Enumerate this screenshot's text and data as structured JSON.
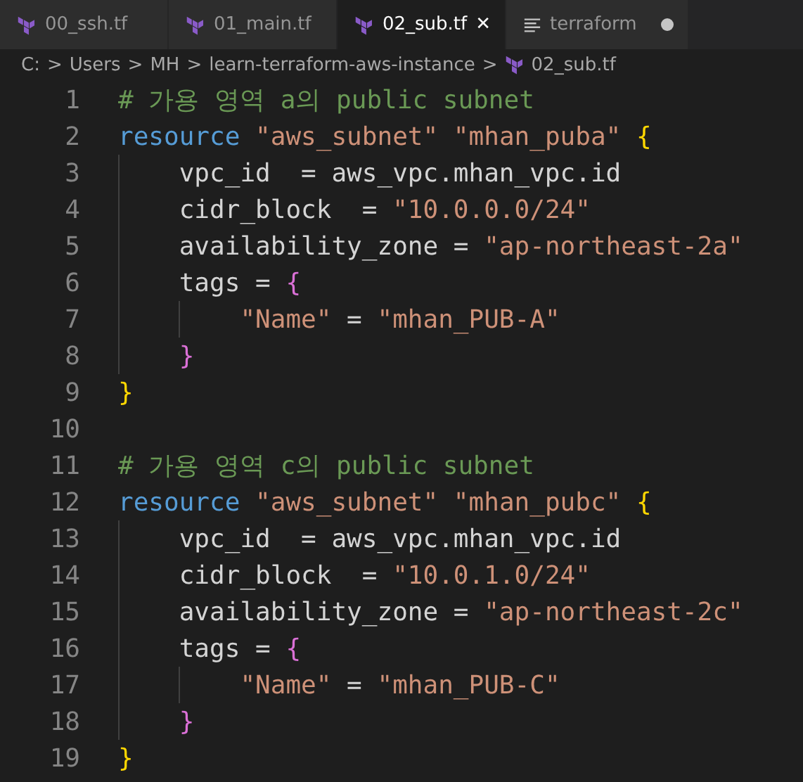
{
  "tabs": [
    {
      "label": "00_ssh.tf",
      "kind": "terraform",
      "selected": false,
      "modified": false
    },
    {
      "label": "01_main.tf",
      "kind": "terraform",
      "selected": false,
      "modified": false
    },
    {
      "label": "02_sub.tf",
      "kind": "terraform",
      "selected": true,
      "modified": false,
      "close": "✕"
    },
    {
      "label": "terraform",
      "kind": "text",
      "selected": false,
      "modified": true
    }
  ],
  "breadcrumb": [
    {
      "label": "C:",
      "kind": "folder"
    },
    {
      "label": "Users",
      "kind": "folder"
    },
    {
      "label": "MH",
      "kind": "folder"
    },
    {
      "label": "learn-terraform-aws-instance",
      "kind": "folder"
    },
    {
      "label": "02_sub.tf",
      "kind": "terraform"
    }
  ],
  "breadcrumb_separator": ">",
  "code": [
    {
      "number": "1",
      "tokens": [
        {
          "kind": "comment",
          "text": "# 가용 영역 a의 public subnet"
        }
      ]
    },
    {
      "number": "2",
      "tokens": [
        {
          "kind": "keyword",
          "text": "resource"
        },
        {
          "kind": "string",
          "text": " \"aws_subnet\""
        },
        {
          "kind": "string",
          "text": " \"mhan_puba\""
        },
        {
          "kind": "brace1",
          "text": " {"
        }
      ]
    },
    {
      "number": "3",
      "tokens": [
        {
          "kind": "plain",
          "text": "    vpc_id  = aws_vpc.mhan_vpc.id"
        }
      ]
    },
    {
      "number": "4",
      "tokens": [
        {
          "kind": "plain",
          "text": "    cidr_block  = "
        },
        {
          "kind": "string",
          "text": "\"10.0.0.0/24\""
        }
      ]
    },
    {
      "number": "5",
      "tokens": [
        {
          "kind": "plain",
          "text": "    availability_zone = "
        },
        {
          "kind": "string",
          "text": "\"ap-northeast-2a\""
        }
      ]
    },
    {
      "number": "6",
      "tokens": [
        {
          "kind": "plain",
          "text": "    tags = "
        },
        {
          "kind": "brace2",
          "text": "{"
        }
      ]
    },
    {
      "number": "7",
      "tokens": [
        {
          "kind": "string",
          "text": "        \"Name\""
        },
        {
          "kind": "plain",
          "text": " = "
        },
        {
          "kind": "string",
          "text": "\"mhan_PUB-A\""
        }
      ]
    },
    {
      "number": "8",
      "tokens": [
        {
          "kind": "brace2",
          "text": "    }"
        }
      ]
    },
    {
      "number": "9",
      "tokens": [
        {
          "kind": "brace1",
          "text": "}"
        }
      ]
    },
    {
      "number": "10"
    },
    {
      "number": "11",
      "tokens": [
        {
          "kind": "comment",
          "text": "# 가용 영역 c의 public subnet"
        }
      ]
    },
    {
      "number": "12",
      "tokens": [
        {
          "kind": "keyword",
          "text": "resource"
        },
        {
          "kind": "string",
          "text": " \"aws_subnet\""
        },
        {
          "kind": "string",
          "text": " \"mhan_pubc\""
        },
        {
          "kind": "brace1",
          "text": " {"
        }
      ]
    },
    {
      "number": "13",
      "tokens": [
        {
          "kind": "plain",
          "text": "    vpc_id  = aws_vpc.mhan_vpc.id"
        }
      ]
    },
    {
      "number": "14",
      "tokens": [
        {
          "kind": "plain",
          "text": "    cidr_block  = "
        },
        {
          "kind": "string",
          "text": "\"10.0.1.0/24\""
        }
      ]
    },
    {
      "number": "15",
      "tokens": [
        {
          "kind": "plain",
          "text": "    availability_zone = "
        },
        {
          "kind": "string",
          "text": "\"ap-northeast-2c\""
        }
      ]
    },
    {
      "number": "16",
      "tokens": [
        {
          "kind": "plain",
          "text": "    tags = "
        },
        {
          "kind": "brace2",
          "text": "{"
        }
      ]
    },
    {
      "number": "17",
      "tokens": [
        {
          "kind": "string",
          "text": "        \"Name\""
        },
        {
          "kind": "plain",
          "text": " = "
        },
        {
          "kind": "string",
          "text": "\"mhan_PUB-C\""
        }
      ]
    },
    {
      "number": "18",
      "tokens": [
        {
          "kind": "brace2",
          "text": "    }"
        }
      ]
    },
    {
      "number": "19",
      "tokens": [
        {
          "kind": "brace1",
          "text": "}"
        }
      ]
    }
  ]
}
